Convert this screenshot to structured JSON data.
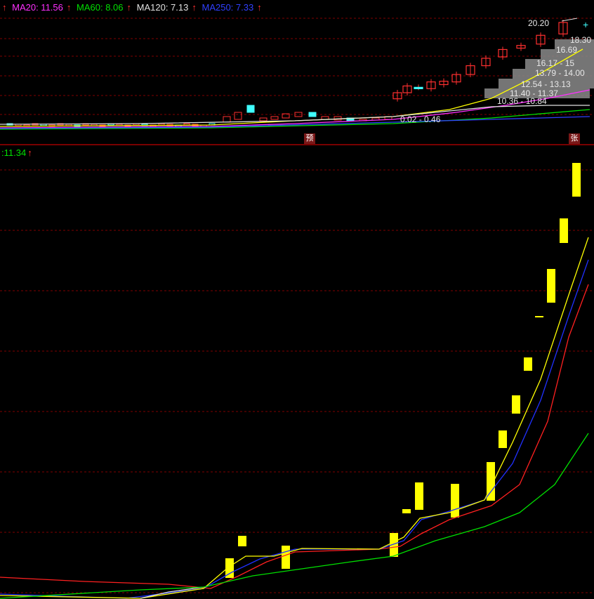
{
  "top_legend": [
    {
      "label": "MA20: 11.56",
      "color": "#ff30ff"
    },
    {
      "label": "MA60: 8.06",
      "color": "#00e000"
    },
    {
      "label": "MA120: 7.13",
      "color": "#e0e0e0"
    },
    {
      "label": "MA250: 7.33",
      "color": "#3040ff"
    }
  ],
  "sub_legend": ":11.34",
  "badges": {
    "yu": "预",
    "zhang": "张"
  },
  "colors": {
    "up": "#ff3030",
    "cyan": "#40ffff",
    "yellow": "#ffff00",
    "blue": "#2030ff",
    "red": "#ff2020",
    "green": "#00e000",
    "grid": "#800000"
  },
  "chart_data": [
    {
      "type": "candlestick",
      "panel": "price",
      "price_labels": [
        "20.20",
        "18.30",
        "16.69",
        "16.17 - 15",
        "13.79 - 14.00",
        "12.54 - 13.13",
        "11.40 - 11.37",
        "10.36 - 10.84",
        "0.02 - 0.46"
      ],
      "recent_candles": [
        {
          "open": 8.9,
          "close": 9.8
        },
        {
          "open": 9.8,
          "close": 10.8
        },
        {
          "open": 10.6,
          "close": 10.6
        },
        {
          "open": 10.4,
          "close": 11.4
        },
        {
          "open": 11.0,
          "close": 11.5
        },
        {
          "open": 11.4,
          "close": 12.5
        },
        {
          "open": 12.5,
          "close": 13.8
        },
        {
          "open": 13.8,
          "close": 14.9
        },
        {
          "open": 15.1,
          "close": 16.2
        },
        {
          "open": 16.4,
          "close": 16.8
        },
        {
          "open": 17.0,
          "close": 18.3
        },
        {
          "open": 18.5,
          "close": 20.2
        }
      ]
    },
    {
      "type": "bar",
      "panel": "indicator",
      "value_label": "11.34",
      "values": [
        1.0,
        2.5,
        1.0,
        1.3,
        2.4,
        1.6,
        1.8,
        2.7,
        3.1,
        3.7,
        4.5,
        5.5,
        7.9,
        9.2
      ]
    }
  ]
}
